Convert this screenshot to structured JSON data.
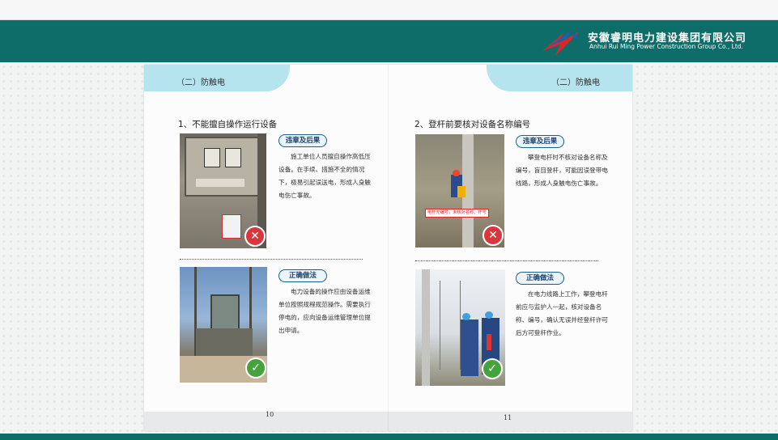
{
  "company": {
    "name_cn": "安徽睿明电力建设集团有限公司",
    "name_en": "Anhui Rui Ming Power Construction Group  Co., Ltd."
  },
  "colors": {
    "brand": "#0e6d68",
    "band": "#b6e4ee",
    "pill_border": "#1c5e8a",
    "bad": "#d9363e",
    "good": "#45a33e"
  },
  "left_page": {
    "band_title": "（二）防触电",
    "section_title": "1、不能擅自操作运行设备",
    "violation_label": "违章及后果",
    "violation_text": "施工单位人员擅自操作高低压设备。在手续、措施不全的情况下，极易引起误送电，形成人身触电伤亡事故。",
    "correct_label": "正确做法",
    "correct_text": "电力设备的操作应由设备运维单位按照规程规范操作。需要执行停电的，应向设备运维管理单位提出申请。",
    "page_number": "10"
  },
  "right_page": {
    "band_title": "（二）防触电",
    "section_title": "2、登杆前要核对设备名称编号",
    "violation_label": "违章及后果",
    "violation_text": "攀登电杆时不核对设备名称及编号，盲目登杆，可能因误登带电线路，形成人身触电伤亡事故。",
    "photo_warning": "电杆无编号，未核对名称、杆号",
    "correct_label": "正确做法",
    "correct_text": "在电力线路上工作，攀登电杆前应与监护人一起，核对设备名称、编号，确认无误并经登杆许可后方可登杆作业。",
    "page_number": "11"
  },
  "icons": {
    "bad": "cross-mark-icon",
    "good": "check-mark-icon"
  }
}
